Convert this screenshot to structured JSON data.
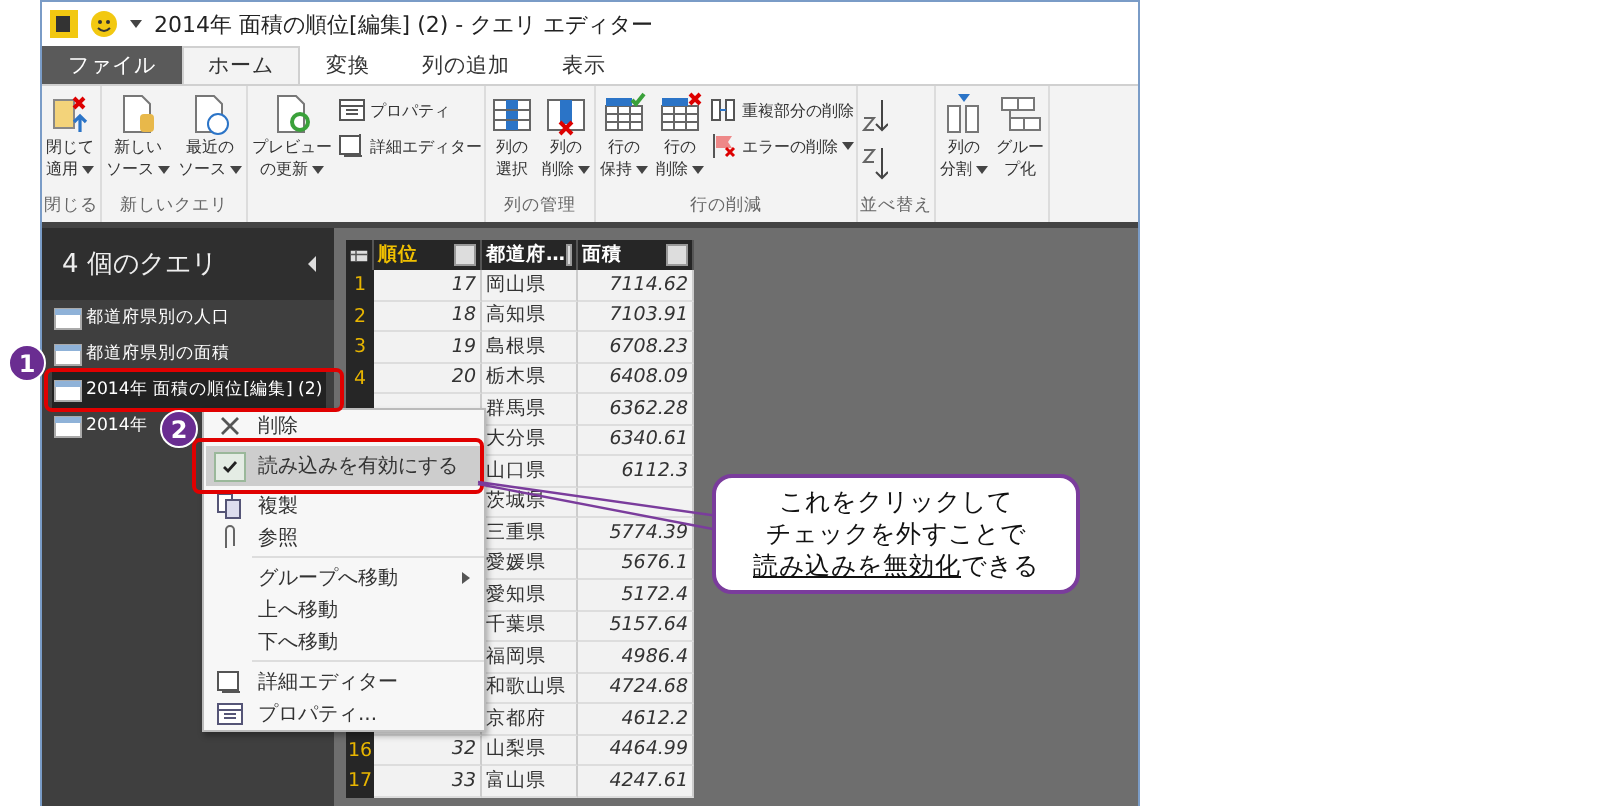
{
  "window": {
    "title": "2014年 面積の順位[編集] (2) - クエリ エディター"
  },
  "ribbon_tabs": [
    {
      "label": "ファイル",
      "kind": "file",
      "selected": false
    },
    {
      "label": "ホーム",
      "kind": "tab",
      "selected": true
    },
    {
      "label": "変換",
      "kind": "tab",
      "selected": false
    },
    {
      "label": "列の追加",
      "kind": "tab",
      "selected": false
    },
    {
      "label": "表示",
      "kind": "tab",
      "selected": false
    }
  ],
  "ribbon_groups": [
    {
      "label": "閉じる",
      "buttons": [
        {
          "kind": "large",
          "lines": [
            "閉じて",
            "適用"
          ],
          "dropdown": true
        }
      ]
    },
    {
      "label": "新しいクエリ",
      "buttons": [
        {
          "kind": "large",
          "lines": [
            "新しい",
            "ソース"
          ],
          "dropdown": true
        },
        {
          "kind": "large",
          "lines": [
            "最近の",
            "ソース"
          ],
          "dropdown": true
        }
      ]
    },
    {
      "buttons": [
        {
          "kind": "large",
          "lines": [
            "プレビュー",
            "の更新"
          ],
          "dropdown": true
        },
        {
          "kind": "small",
          "lines": [
            "プロパティ"
          ],
          "dropdown": false
        },
        {
          "kind": "small",
          "lines": [
            "詳細エディター"
          ],
          "dropdown": false
        }
      ]
    },
    {
      "label": "列の管理",
      "buttons": [
        {
          "kind": "large",
          "lines": [
            "列の",
            "選択"
          ],
          "dropdown": false
        },
        {
          "kind": "large",
          "lines": [
            "列の",
            "削除"
          ],
          "dropdown": true
        }
      ]
    },
    {
      "label": "行の削減",
      "buttons": [
        {
          "kind": "large",
          "lines": [
            "行の",
            "保持"
          ],
          "dropdown": true
        },
        {
          "kind": "large",
          "lines": [
            "行の",
            "削除"
          ],
          "dropdown": true
        },
        {
          "kind": "small",
          "lines": [
            "重複部分の削除"
          ],
          "dropdown": false
        },
        {
          "kind": "small",
          "lines": [
            "エラーの削除"
          ],
          "dropdown": true
        }
      ]
    },
    {
      "label": "並べ替え",
      "buttons": [
        {
          "kind": "icon"
        },
        {
          "kind": "icon"
        }
      ]
    },
    {
      "buttons": [
        {
          "kind": "large",
          "lines": [
            "列の",
            "分割"
          ],
          "dropdown": true
        },
        {
          "kind": "large",
          "lines": [
            "グルー",
            "プ化"
          ],
          "dropdown": false
        }
      ]
    }
  ],
  "queries_panel": {
    "title": "4 個のクエリ",
    "items": [
      {
        "label": "都道府県別の人口",
        "selected": false
      },
      {
        "label": "都道府県別の面積",
        "selected": false
      },
      {
        "label": "2014年 面積の順位[編集] (2)",
        "selected": true
      },
      {
        "label": "2014年",
        "selected": false
      }
    ]
  },
  "table": {
    "columns": [
      "順位",
      "都道府…",
      "面積"
    ],
    "rows": [
      {
        "row_number": "1",
        "rank": "17",
        "prefecture": "岡山県",
        "area": "7114.62"
      },
      {
        "row_number": "2",
        "rank": "18",
        "prefecture": "高知県",
        "area": "7103.91"
      },
      {
        "row_number": "3",
        "rank": "19",
        "prefecture": "島根県",
        "area": "6708.23"
      },
      {
        "row_number": "4",
        "rank": "20",
        "prefecture": "栃木県",
        "area": "6408.09"
      },
      {
        "prefecture": "群馬県",
        "area": "6362.28"
      },
      {
        "prefecture": "大分県",
        "area": "6340.61"
      },
      {
        "prefecture": "山口県",
        "area": "6112.3"
      },
      {
        "prefecture": "茨城県"
      },
      {
        "prefecture": "三重県",
        "area": "5774.39"
      },
      {
        "prefecture": "愛媛県",
        "area": "5676.1"
      },
      {
        "prefecture": "愛知県",
        "area": "5172.4"
      },
      {
        "prefecture": "千葉県",
        "area": "5157.64"
      },
      {
        "prefecture": "福岡県",
        "area": "4986.4"
      },
      {
        "prefecture": "和歌山県",
        "area": "4724.68"
      },
      {
        "prefecture": "京都府",
        "area": "4612.2"
      },
      {
        "row_number": "16",
        "rank": "32",
        "prefecture": "山梨県",
        "area": "4464.99"
      },
      {
        "row_number": "17",
        "rank": "33",
        "prefecture": "富山県",
        "area": "4247.61"
      }
    ]
  },
  "context_menu": {
    "items": [
      {
        "kind": "item",
        "label": "削除",
        "checked": false,
        "highlighted": false,
        "submenu": false
      },
      {
        "kind": "item",
        "label": "読み込みを有効にする",
        "checked": true,
        "highlighted": true,
        "submenu": false
      },
      {
        "kind": "item",
        "label": "複製",
        "checked": false,
        "highlighted": false,
        "submenu": false
      },
      {
        "kind": "item",
        "label": "参照",
        "checked": false,
        "highlighted": false,
        "submenu": false
      },
      {
        "kind": "separator"
      },
      {
        "kind": "item",
        "label": "グループへ移動",
        "checked": false,
        "highlighted": false,
        "submenu": true
      },
      {
        "kind": "item",
        "label": "上へ移動",
        "checked": false,
        "highlighted": false,
        "submenu": false
      },
      {
        "kind": "item",
        "label": "下へ移動",
        "checked": false,
        "highlighted": false,
        "submenu": false
      },
      {
        "kind": "separator"
      },
      {
        "kind": "item",
        "label": "詳細エディター",
        "checked": false,
        "highlighted": false,
        "submenu": false
      },
      {
        "kind": "item",
        "label": "プロパティ...",
        "checked": false,
        "highlighted": false,
        "submenu": false
      }
    ]
  },
  "step_badges": [
    "1",
    "2"
  ],
  "callout": {
    "lines": [
      [
        {
          "text": "これをクリックして",
          "underline": false
        }
      ],
      [
        {
          "text": "チェックを外すことで",
          "underline": false
        }
      ],
      [
        {
          "text": "読み込みを無効化",
          "underline": true
        },
        {
          "text": "できる",
          "underline": false
        }
      ]
    ]
  }
}
